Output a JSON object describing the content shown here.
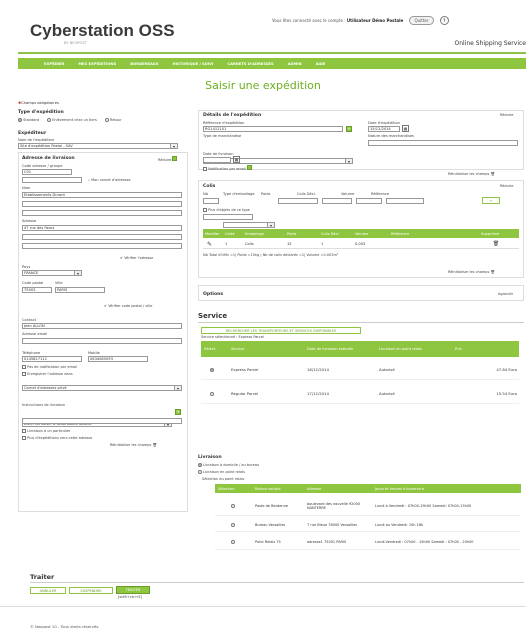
{
  "brand": {
    "name": "Cyberstation OSS",
    "sub": "BY NEOPOST",
    "tagline": "Online Shipping Service"
  },
  "topbar": {
    "connected": "Vous êtes connecté avec le compte :",
    "user": "Utilisateur Démo Postale",
    "quit": "Quitter",
    "help": "?"
  },
  "nav": [
    "EXPÉDIER",
    "MES EXPÉDITIONS",
    "BORDEREAUX",
    "HISTORIQUE / SUIVI",
    "CARNETS D'ADRESSES",
    "ADMIN",
    "AIDE"
  ],
  "page_title": "Saisir une expédition",
  "required_note": "Champs obligatoires",
  "type": {
    "title": "Type d'expédition",
    "options": [
      "Standard",
      "Enlèvement chez un tiers",
      "Retour"
    ]
  },
  "sender": {
    "title": "Expéditeur",
    "label": "Nom de l'expéditeur",
    "value": "Site d'expédition Postal - SAV"
  },
  "delivery": {
    "title": "Adresse de livraison",
    "collapse": "Réduire",
    "code_label": "Code adresse / groupe",
    "code": "C01",
    "book": "Mon carnet d'adresses",
    "name_label": "Nom",
    "name": "Etablissements Durant",
    "address_label": "Adresse",
    "address": "47 rue des fleurs",
    "verify_address": "Vérifier l'adresse",
    "country_label": "Pays",
    "country": "FRANCE",
    "zip_label": "Code postal",
    "city_label": "Ville",
    "zip": "75003",
    "city": "PARIS",
    "verify_zip": "Vérifier code postal / ville"
  },
  "contact": {
    "label": "Contact",
    "value": "Jean ALLON",
    "email_label": "Adresse email",
    "phone_label": "Téléphone",
    "phone": "0145827112",
    "mobile_label": "Mobile",
    "mobile": "0634085093",
    "no_notif": "Pas de notification par email",
    "save_in": "Enregistrer l'adresse dans",
    "book_value": "Carnet d'adresses privé"
  },
  "instructions": {
    "label": "Instructions de livraison",
    "value": "Livrer au voisin si destinataire absent",
    "opt1": "Livraison à un particulier",
    "opt2": "Plus d'expéditions vers cette adresse",
    "reset": "Réinitialiser les champs"
  },
  "details": {
    "title": "Détails de l'expédition",
    "collapse": "Réduire",
    "ref_label": "Référence d'expédition",
    "ref": "RG1412101",
    "date_label": "Date d'expédition",
    "date": "15/12/2014",
    "goods_type_label": "Type de marchandise",
    "goods_nature_label": "Nature des marchandises",
    "delivery_date_label": "Date de livraison",
    "notif": "Notification par email",
    "reset": "Réinitialiser les champs"
  },
  "parcels": {
    "title": "Colis",
    "collapse": "Réduire",
    "labels": [
      "Nb",
      "Type d'emballage",
      "Poids",
      "Colis Décl.",
      "Volume",
      "Référence"
    ],
    "same_type": "Plus d'objets de ce type",
    "headers": [
      "Modifier",
      "Unité",
      "Emballage",
      "Poids",
      "Colis Décl.",
      "Volume",
      "Référence",
      "Supprimer"
    ],
    "row": [
      "1",
      "Colis",
      "15",
      "1",
      "0.003"
    ],
    "total": "Nb Total d'UMs =1| Poids =15kg | Nb de colis déclarés =1| Volume =0.003m³",
    "reset": "Réinitialiser les champs"
  },
  "options": {
    "title": "Options",
    "expand": "Agrandir"
  },
  "service": {
    "title": "Service",
    "search_btn": "RECHERCHER LES TRANSPORTEURS ET SERVICES DISPONIBLES",
    "selected": "Service sélectionné : Express Parcel",
    "headers": [
      "Sélect.",
      "Service",
      "Date de livraison estimée",
      "Livraison en point relais",
      "Prix"
    ],
    "rows": [
      {
        "name": "Express Parcel",
        "date": "16/12/2014",
        "relay": "Autorisé",
        "price": "47.84 Euro",
        "selected": true
      },
      {
        "name": "Regular Parcel",
        "date": "17/12/2014",
        "relay": "Autorisé",
        "price": "15.54 Euro",
        "selected": false
      }
    ]
  },
  "livraison": {
    "title": "Livraison",
    "opt1": "Livraison à domicile / au bureau",
    "opt2": "Livraison en point relais",
    "sel": "Sélection du point relais",
    "headers": [
      "Sélection",
      "Raison sociale",
      "Adresse",
      "Jours et heures d'ouverture"
    ],
    "rows": [
      {
        "name": "Poste de Berdenne",
        "addr": "boulevard des nouvelle 92000 NANTERRE",
        "hours": "Lundi à Vendredi : 07h00-19h00 Samedi: 07h00-13h00"
      },
      {
        "name": "Bureau Versailles",
        "addr": "7 rue Bleue 78000 Versailles",
        "hours": "Lundi au Vendredi: 10h 18h"
      },
      {
        "name": "Point Relais 75",
        "addr": "adresse1 75001 PARIS",
        "hours": "Lundi-Vendredi : 07h00 - 19h00 Samedi : 07h00 - 20h00"
      }
    ]
  },
  "treat": {
    "title": "Traiter",
    "cancel": "ANNULER",
    "suspend": "SUSPENDRE",
    "process": "TRAITER",
    "shortcut": "[shift+ctrl+E]"
  },
  "footer": "© Neopost 10 - Tous droits réservés."
}
